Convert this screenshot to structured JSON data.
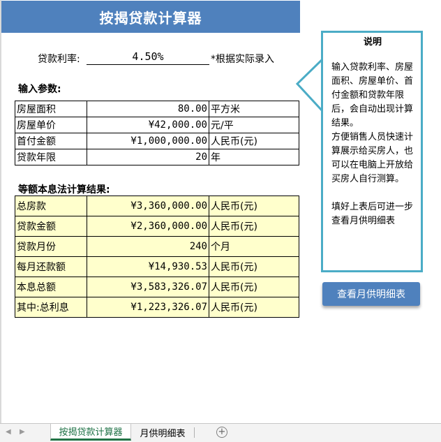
{
  "title": "按揭贷款计算器",
  "rate": {
    "label": "贷款利率:",
    "value": "4.50%",
    "note": "*根据实际录入"
  },
  "inputs": {
    "heading": "输入参数:",
    "rows": [
      {
        "label": "房屋面积",
        "value": "80.00",
        "unit": "平方米"
      },
      {
        "label": "房屋单价",
        "value": "¥42,000.00",
        "unit": "元/平"
      },
      {
        "label": "首付金额",
        "value": "¥1,000,000.00",
        "unit": "人民币(元)"
      },
      {
        "label": "贷款年限",
        "value": "20",
        "unit": "年"
      }
    ]
  },
  "results": {
    "heading": "等额本息法计算结果:",
    "rows": [
      {
        "label": "总房款",
        "value": "¥3,360,000.00",
        "unit": "人民币(元)"
      },
      {
        "label": "贷款金额",
        "value": "¥2,360,000.00",
        "unit": "人民币(元)"
      },
      {
        "label": "贷款月份",
        "value": "240",
        "unit": "个月"
      },
      {
        "label": "每月还款额",
        "value": "¥14,930.53",
        "unit": "人民币(元)"
      },
      {
        "label": "本息总额",
        "value": "¥3,583,326.07",
        "unit": "人民币(元)"
      },
      {
        "label": "其中:总利息",
        "value": "¥1,223,326.07",
        "unit": "人民币(元)"
      }
    ]
  },
  "callout": {
    "title": "说明",
    "body": "输入贷款利率、房屋面积、房屋单价、首付金额和贷款年限后，会自动出现计算结果。\n方便销售人员快速计算展示给买房人，也可以在电脑上开放给买房人自行测算。\n\n填好上表后可进一步查看月供明细表"
  },
  "button": {
    "label": "查看月供明细表"
  },
  "tabs": {
    "items": [
      {
        "label": "按揭贷款计算器",
        "active": true
      },
      {
        "label": "月供明细表",
        "active": false
      }
    ],
    "add_label": "+"
  },
  "colors": {
    "title_bg": "#4f81bd",
    "button_bg": "#4f81bd",
    "callout_border": "#4bacc6",
    "result_fill": "#ffffcc",
    "active_tab_text": "#1e7145"
  }
}
